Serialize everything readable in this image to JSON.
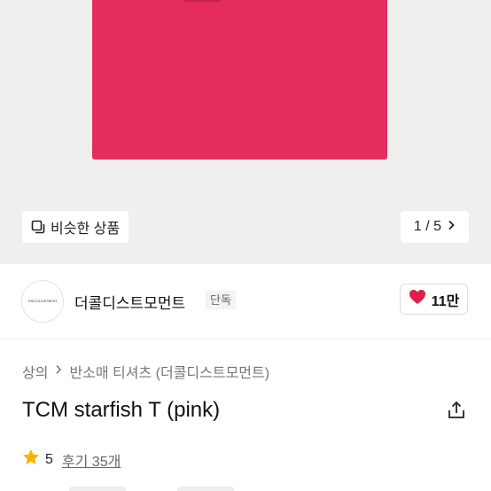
{
  "colors": {
    "product": "#e42c5f",
    "heart": "#e0204b",
    "star": "#f5b301"
  },
  "image_actions": {
    "similar_label": "비슷한 상품",
    "page_indicator": "1 / 5"
  },
  "store": {
    "logo_text": "THECOLDISTMENT",
    "name": "더콜디스트모먼트",
    "badge": "단독",
    "likes": "11만"
  },
  "breadcrumb": {
    "category": "상의",
    "subcategory": "반소매 티셔츠 (더콜디스트모먼트)"
  },
  "product": {
    "title": "TCM starfish T (pink)"
  },
  "rating": {
    "score": "5",
    "reviews": "후기 35개"
  }
}
